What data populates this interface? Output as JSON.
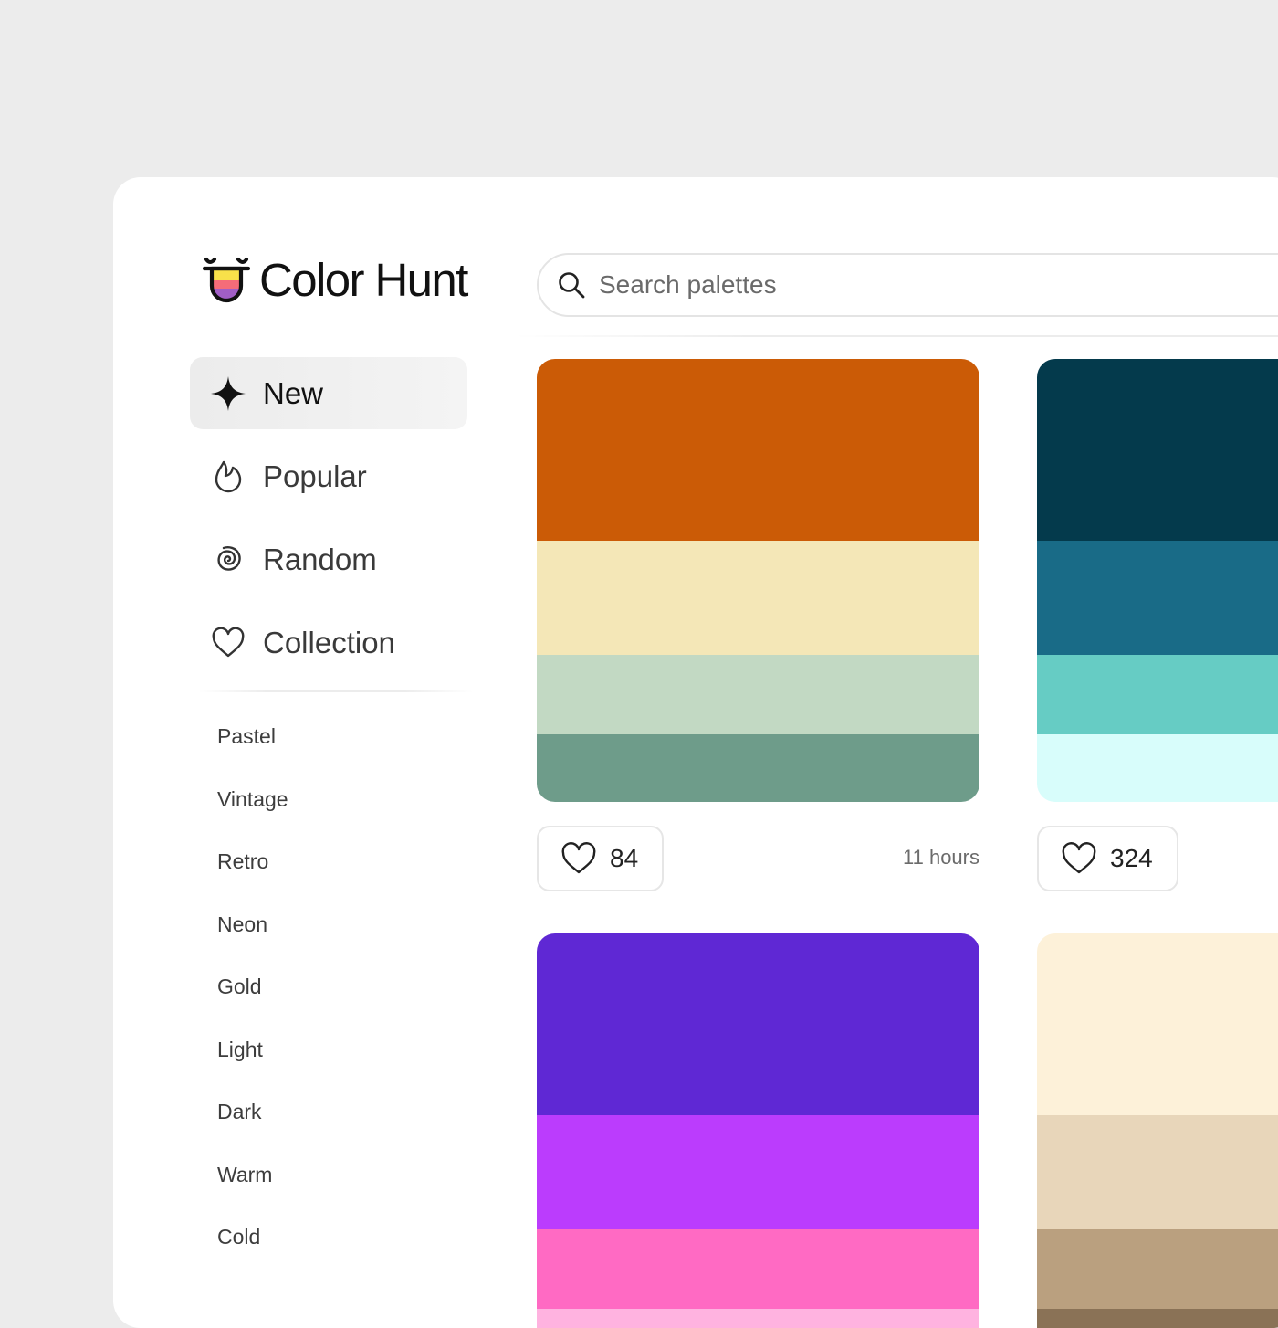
{
  "app": {
    "brand_name": "Color Hunt",
    "logo_colors": [
      "#f8e14a",
      "#f56c79",
      "#a15ec6"
    ]
  },
  "search": {
    "placeholder": "Search palettes",
    "value": ""
  },
  "nav": {
    "items": [
      {
        "label": "New",
        "icon": "sparkle-icon",
        "active": true
      },
      {
        "label": "Popular",
        "icon": "flame-icon",
        "active": false
      },
      {
        "label": "Random",
        "icon": "spiral-icon",
        "active": false
      },
      {
        "label": "Collection",
        "icon": "heart-icon",
        "active": false
      }
    ]
  },
  "tags": [
    "Pastel",
    "Vintage",
    "Retro",
    "Neon",
    "Gold",
    "Light",
    "Dark",
    "Warm",
    "Cold"
  ],
  "palettes": [
    {
      "colors": [
        "#cb5b06",
        "#f4e7b7",
        "#c2d9c3",
        "#6e9c8a"
      ],
      "likes": "84",
      "time": "11 hours"
    },
    {
      "colors": [
        "#043a4c",
        "#196b87",
        "#66ccc4",
        "#d8fdfb"
      ],
      "likes": "324",
      "time": ""
    },
    {
      "colors": [
        "#5f28d4",
        "#bb3cfd",
        "#ff6ac3",
        "#ffb3e0"
      ],
      "likes": "",
      "time": ""
    },
    {
      "colors": [
        "#fdf1d9",
        "#e8d6ba",
        "#baa07f",
        "#8a7256"
      ],
      "likes": "",
      "time": ""
    }
  ]
}
